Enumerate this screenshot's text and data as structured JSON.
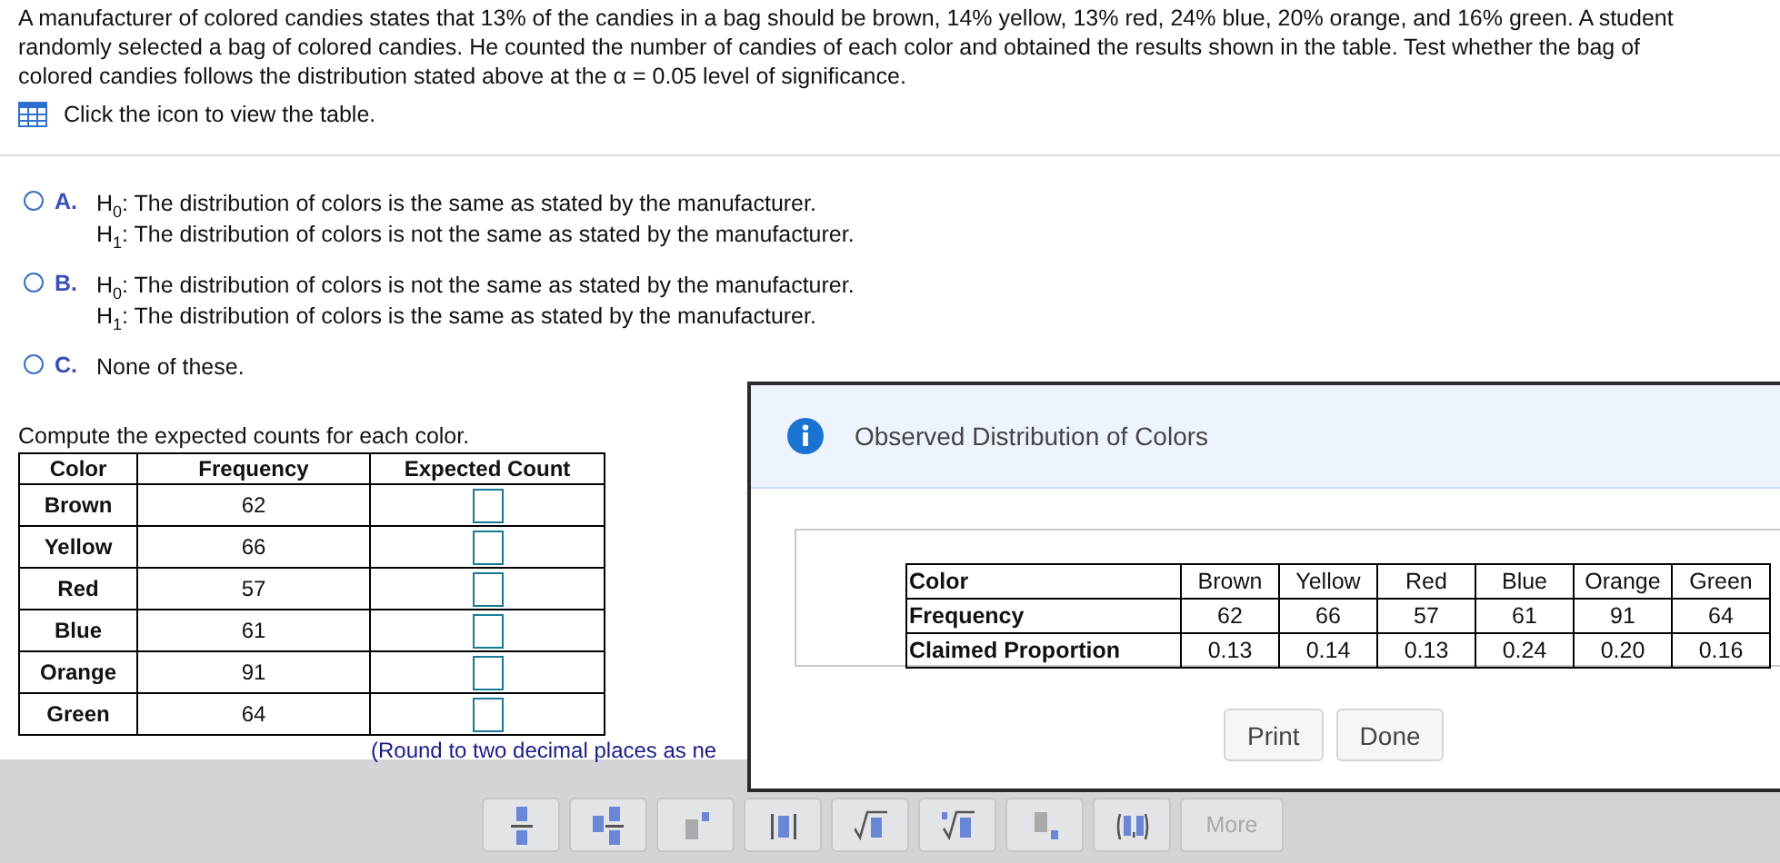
{
  "question": "A manufacturer of colored candies states that 13% of the candies in a bag should be brown, 14% yellow, 13% red, 24% blue, 20% orange, and 16% green. A student randomly selected a bag of colored candies. He counted the number of candies of each color and obtained the results shown in the table. Test whether the bag of colored candies follows the distribution stated above at the α = 0.05 level of significance.",
  "table_link": "Click the icon to view the table.",
  "options": [
    {
      "letter": "A.",
      "lines": [
        "H$_{0}$: The distribution of colors is the same as stated by the manufacturer.",
        "H$_{1}$: The distribution of colors is not the same as stated by the manufacturer."
      ],
      "selected": false
    },
    {
      "letter": "B.",
      "lines": [
        "H$_{0}$: The distribution of colors is not the same as stated by the manufacturer.",
        "H$_{1}$: The distribution of colors is the same as stated by the manufacturer."
      ],
      "selected": false
    },
    {
      "letter": "C.",
      "lines": [
        "None of these."
      ],
      "selected": false
    }
  ],
  "prompt": "Compute the expected counts for each color.",
  "answer_table": {
    "columns": [
      "Color",
      "Frequency",
      "Expected Count"
    ],
    "rows": [
      {
        "name": "Brown",
        "frequency": "62"
      },
      {
        "name": "Yellow",
        "frequency": "66"
      },
      {
        "name": "Red",
        "frequency": "57"
      },
      {
        "name": "Blue",
        "frequency": "61"
      },
      {
        "name": "Orange",
        "frequency": "91"
      },
      {
        "name": "Green",
        "frequency": "64"
      }
    ]
  },
  "hint": "(Round to two decimal places as ne",
  "toolbar": [
    {
      "kind": "fraction"
    },
    {
      "kind": "mixed"
    },
    {
      "kind": "exponent"
    },
    {
      "kind": "abs"
    },
    {
      "kind": "sqrt"
    },
    {
      "kind": "nthroot"
    },
    {
      "kind": "subscript"
    },
    {
      "kind": "pair"
    },
    {
      "kind": "text",
      "label": "More"
    }
  ],
  "dialog": {
    "title": "Observed Distribution of Colors",
    "table": [
      [
        "Color",
        "Brown",
        "Yellow",
        "Red",
        "Blue",
        "Orange",
        "Green"
      ],
      [
        "Frequency",
        "62",
        "66",
        "57",
        "61",
        "91",
        "64"
      ],
      [
        "Claimed Proportion",
        "0.13",
        "0.14",
        "0.13",
        "0.24",
        "0.20",
        "0.16"
      ]
    ],
    "buttons": [
      "Print",
      "Done"
    ]
  }
}
